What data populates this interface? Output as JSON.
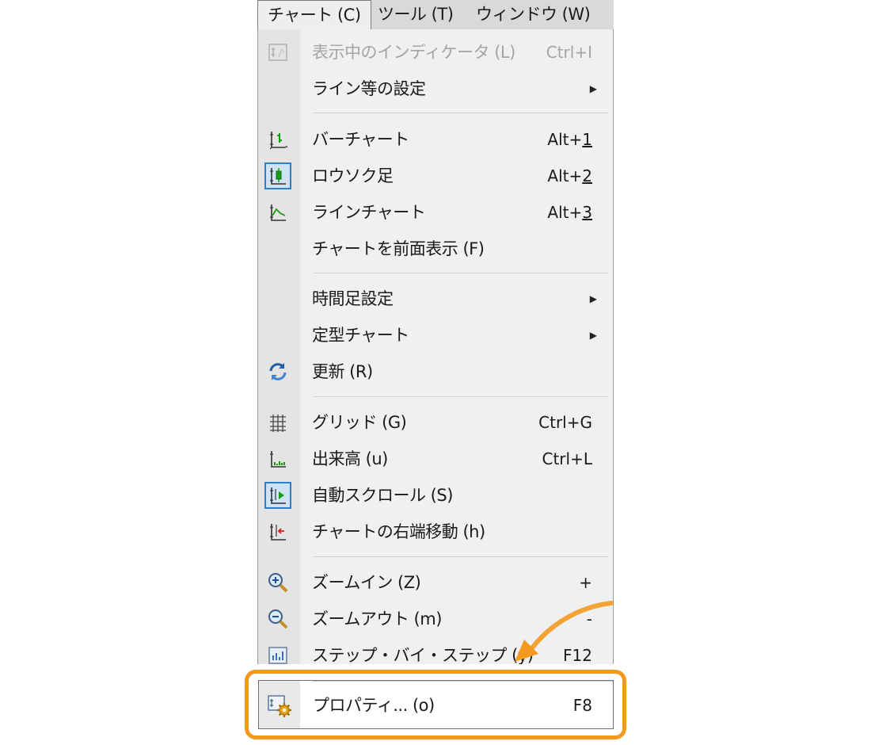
{
  "menubar": [
    {
      "label": "チャート (C)",
      "active": true
    },
    {
      "label": "ツール (T)",
      "active": false
    },
    {
      "label": "ウィンドウ (W)",
      "active": false
    }
  ],
  "menu": {
    "groups": [
      [
        {
          "label": "表示中のインディケータ (L)",
          "shortcut": "Ctrl+I",
          "icon": "indicator-list-icon",
          "disabled": true
        },
        {
          "label": "ライン等の設定",
          "submenu": true
        }
      ],
      [
        {
          "label": "バーチャート",
          "shortcut_prefix": "Alt+",
          "shortcut_key": "1",
          "icon": "bar-chart-icon"
        },
        {
          "label": "ロウソク足",
          "shortcut_prefix": "Alt+",
          "shortcut_key": "2",
          "icon": "candlestick-icon",
          "checked": true
        },
        {
          "label": "ラインチャート",
          "shortcut_prefix": "Alt+",
          "shortcut_key": "3",
          "icon": "line-chart-icon"
        },
        {
          "label": "チャートを前面表示 (F)"
        }
      ],
      [
        {
          "label": "時間足設定",
          "submenu": true
        },
        {
          "label": "定型チャート",
          "submenu": true
        },
        {
          "label": "更新 (R)",
          "icon": "refresh-icon"
        }
      ],
      [
        {
          "label": "グリッド (G)",
          "shortcut": "Ctrl+G",
          "icon": "grid-icon"
        },
        {
          "label": "出来高 (u)",
          "shortcut": "Ctrl+L",
          "icon": "volume-icon"
        },
        {
          "label": "自動スクロール (S)",
          "icon": "auto-scroll-icon",
          "checked": true
        },
        {
          "label": "チャートの右端移動 (h)",
          "icon": "chart-shift-icon"
        }
      ],
      [
        {
          "label": "ズームイン (Z)",
          "shortcut": "+",
          "icon": "zoom-in-icon"
        },
        {
          "label": "ズームアウト (m)",
          "shortcut": "-",
          "icon": "zoom-out-icon"
        },
        {
          "label": "ステップ・バイ・ステップ (y)",
          "shortcut": "F12",
          "icon": "step-by-step-icon"
        }
      ]
    ],
    "highlighted": {
      "label": "プロパティ... (o)",
      "shortcut": "F8",
      "icon": "properties-gear-icon"
    }
  },
  "colors": {
    "highlight": "#f39a1e",
    "checked_border": "#2f7fc4",
    "icon_green": "#1a9a1a",
    "icon_blue": "#1f5fa8"
  }
}
